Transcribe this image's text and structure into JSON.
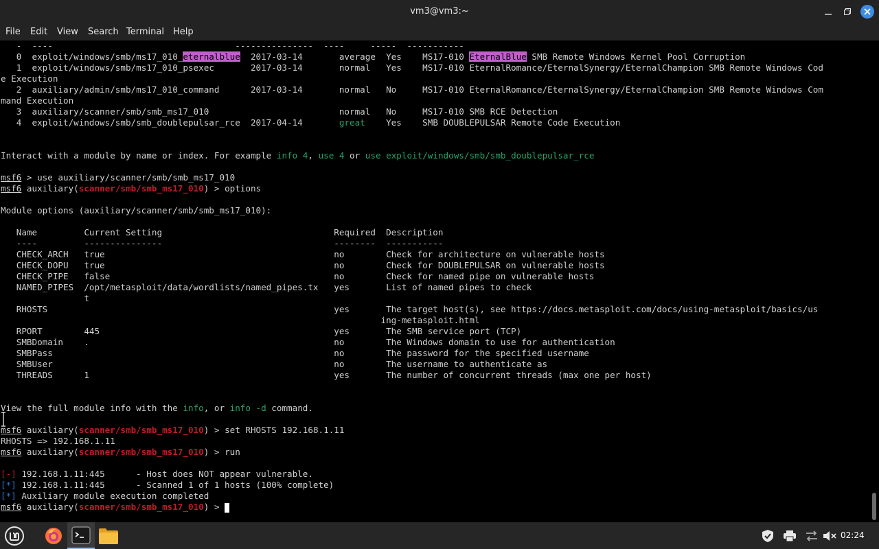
{
  "window": {
    "title": "vm3@vm3:~"
  },
  "menu": [
    "File",
    "Edit",
    "View",
    "Search",
    "Terminal",
    "Help"
  ],
  "terminal": {
    "lines": [
      [
        {
          "t": "   -  ----                                   ---------------  ----     -----  -----------"
        }
      ],
      [
        {
          "t": "   0  exploit/windows/smb/ms17_010_"
        },
        {
          "t": "eternalblue",
          "c": "c-hl"
        },
        {
          "t": "  2017-03-14       average  Yes    MS17-010 "
        },
        {
          "t": "EternalBlue",
          "c": "c-hl"
        },
        {
          "t": " SMB Remote Windows Kernel Pool Corruption"
        }
      ],
      [
        {
          "t": "   1  exploit/windows/smb/ms17_010_psexec       2017-03-14       normal   Yes    MS17-010 EternalRomance/EternalSynergy/EternalChampion SMB Remote Windows Cod"
        }
      ],
      [
        {
          "t": "e Execution"
        }
      ],
      [
        {
          "t": "   2  auxiliary/admin/smb/ms17_010_command      2017-03-14       normal   No     MS17-010 EternalRomance/EternalSynergy/EternalChampion SMB Remote Windows Com"
        }
      ],
      [
        {
          "t": "mand Execution"
        }
      ],
      [
        {
          "t": "   3  auxiliary/scanner/smb/smb_ms17_010                         normal   No     MS17-010 SMB RCE Detection"
        }
      ],
      [
        {
          "t": "   4  exploit/windows/smb/smb_doublepulsar_rce  2017-04-14       "
        },
        {
          "t": "great",
          "c": "c-green"
        },
        {
          "t": "    Yes    SMB DOUBLEPULSAR Remote Code Execution"
        }
      ],
      [
        {
          "t": ""
        }
      ],
      [
        {
          "t": ""
        }
      ],
      [
        {
          "t": "Interact with a module by name or index. For example "
        },
        {
          "t": "info 4",
          "c": "c-green"
        },
        {
          "t": ", "
        },
        {
          "t": "use 4",
          "c": "c-green"
        },
        {
          "t": " or "
        },
        {
          "t": "use exploit/windows/smb/smb_doublepulsar_rce",
          "c": "c-green"
        }
      ],
      [
        {
          "t": ""
        }
      ],
      [
        {
          "t": "msf6",
          "c": "u"
        },
        {
          "t": " > use auxiliary/scanner/smb/smb_ms17_010"
        }
      ],
      [
        {
          "t": "msf6",
          "c": "u"
        },
        {
          "t": " auxiliary("
        },
        {
          "t": "scanner/smb/smb_ms17_010",
          "c": "c-red"
        },
        {
          "t": ") > options"
        }
      ],
      [
        {
          "t": ""
        }
      ],
      [
        {
          "t": "Module options (auxiliary/scanner/smb/smb_ms17_010):"
        }
      ],
      [
        {
          "t": ""
        }
      ],
      [
        {
          "t": "   Name         Current Setting                                 Required  Description"
        }
      ],
      [
        {
          "t": "   ----         ---------------                                 --------  -----------"
        }
      ],
      [
        {
          "t": "   CHECK_ARCH   true                                            no        Check for architecture on vulnerable hosts"
        }
      ],
      [
        {
          "t": "   CHECK_DOPU   true                                            no        Check for DOUBLEPULSAR on vulnerable hosts"
        }
      ],
      [
        {
          "t": "   CHECK_PIPE   false                                           no        Check for named pipe on vulnerable hosts"
        }
      ],
      [
        {
          "t": "   NAMED_PIPES  /opt/metasploit/data/wordlists/named_pipes.tx   yes       List of named pipes to check"
        }
      ],
      [
        {
          "t": "                t"
        }
      ],
      [
        {
          "t": "   RHOSTS                                                       yes       The target host(s), see https://docs.metasploit.com/docs/using-metasploit/basics/us"
        }
      ],
      [
        {
          "t": "                                                                         ing-metasploit.html"
        }
      ],
      [
        {
          "t": "   RPORT        445                                             yes       The SMB service port (TCP)"
        }
      ],
      [
        {
          "t": "   SMBDomain    .                                               no        The Windows domain to use for authentication"
        }
      ],
      [
        {
          "t": "   SMBPass                                                      no        The password for the specified username"
        }
      ],
      [
        {
          "t": "   SMBUser                                                      no        The username to authenticate as"
        }
      ],
      [
        {
          "t": "   THREADS      1                                               yes       The number of concurrent threads (max one per host)"
        }
      ],
      [
        {
          "t": ""
        }
      ],
      [
        {
          "t": ""
        }
      ],
      [
        {
          "t": "View the full module info with the "
        },
        {
          "t": "info",
          "c": "c-green"
        },
        {
          "t": ", or "
        },
        {
          "t": "info -d",
          "c": "c-green"
        },
        {
          "t": " command."
        }
      ],
      [
        {
          "t": ""
        }
      ],
      [
        {
          "t": "msf6",
          "c": "u"
        },
        {
          "t": " auxiliary("
        },
        {
          "t": "scanner/smb/smb_ms17_010",
          "c": "c-red"
        },
        {
          "t": ") > set RHOSTS 192.168.1.11"
        }
      ],
      [
        {
          "t": "RHOSTS => 192.168.1.11"
        }
      ],
      [
        {
          "t": "msf6",
          "c": "u"
        },
        {
          "t": " auxiliary("
        },
        {
          "t": "scanner/smb/smb_ms17_010",
          "c": "c-red"
        },
        {
          "t": ") > run"
        }
      ],
      [
        {
          "t": ""
        }
      ],
      [
        {
          "t": "[-]",
          "c": "c-red2"
        },
        {
          "t": " 192.168.1.11:445      - Host does NOT appear vulnerable."
        }
      ],
      [
        {
          "t": "[*]",
          "c": "c-blue"
        },
        {
          "t": " 192.168.1.11:445      - Scanned 1 of 1 hosts (100% complete)"
        }
      ],
      [
        {
          "t": "[*]",
          "c": "c-blue"
        },
        {
          "t": " Auxiliary module execution completed"
        }
      ],
      [
        {
          "t": "msf6",
          "c": "u"
        },
        {
          "t": " auxiliary("
        },
        {
          "t": "scanner/smb/smb_ms17_010",
          "c": "c-red"
        },
        {
          "t": ") > "
        },
        {
          "cursor": true
        }
      ]
    ]
  },
  "taskbar": {
    "clock": "02:24",
    "apps": [
      "mint-menu-icon",
      "firefox-icon",
      "terminal-icon",
      "files-icon"
    ],
    "tray": [
      "shield-icon",
      "printer-icon",
      "network-icon",
      "volume-muted-icon"
    ]
  },
  "colors": {
    "accent": "#3d8ee3",
    "prompt_red": "#c01c28",
    "hint_green": "#26a269",
    "highlight": "#c061cb"
  }
}
